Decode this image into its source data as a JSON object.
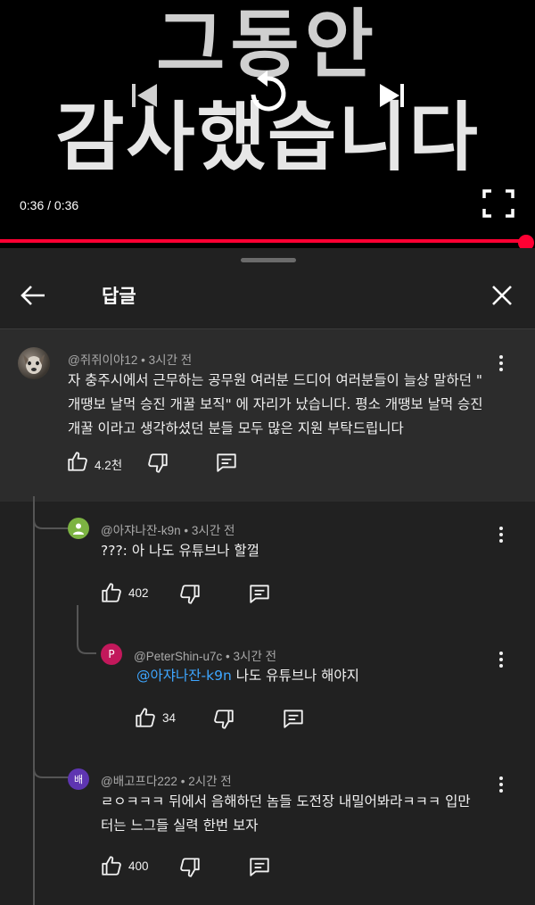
{
  "video": {
    "caption_line1": "그동안",
    "caption_line2": "감사했습니다",
    "time": "0:36 / 0:36",
    "progress": 1.0,
    "icons": [
      "skip-previous-icon",
      "replay-icon",
      "skip-next-icon",
      "fullscreen-icon"
    ]
  },
  "header": {
    "title": "답글",
    "back_icon": "arrow-left-icon",
    "close_icon": "close-icon"
  },
  "comments": [
    {
      "author": "@쥐쥐이야12",
      "time": "3시간 전",
      "lines": [
        "자 충주시에서 근무하는 공무원 여러분 드디어 여러분들이 늘상 말하던 \"",
        "개땡보 날먹 승진 개꿀 보직\" 에 자리가 났습니다. 평소 개땡보 날먹 승진",
        "개꿀 이라고 생각하셨던 분들 모두 많은 지원 부탁드립니다"
      ],
      "likes": "4.2천",
      "avatar": "photo"
    },
    {
      "author": "@아쟈나잔-k9n",
      "time": "3시간 전",
      "lines": [
        "???: 아 나도 유튜브나 할껄"
      ],
      "likes": "402",
      "avatar_color": "#7cb342"
    },
    {
      "author": "@PeterShin-u7c",
      "time": "3시간 전",
      "mention": "@아쟈나잔-k9n",
      "lines": [
        "나도 유튜브나 해야지"
      ],
      "likes": "34",
      "avatar_letter": "P",
      "avatar_color": "#c2185b"
    },
    {
      "author": "@배고프다222",
      "time": "2시간 전",
      "lines": [
        "ㄹㅇㅋㅋㅋ 뒤에서 음해하던 놈들 도전장 내밀어봐라ㅋㅋㅋ 입만",
        "터는 느그들 실력 한번 보자"
      ],
      "likes": "400",
      "avatar_letter": "배",
      "avatar_color": "#5e35b1"
    }
  ],
  "separator": "•",
  "colors": {
    "accent": "#ff0033",
    "mention": "#3ea6ff",
    "sheet": "#212121",
    "highlight": "#2c2c2c"
  }
}
